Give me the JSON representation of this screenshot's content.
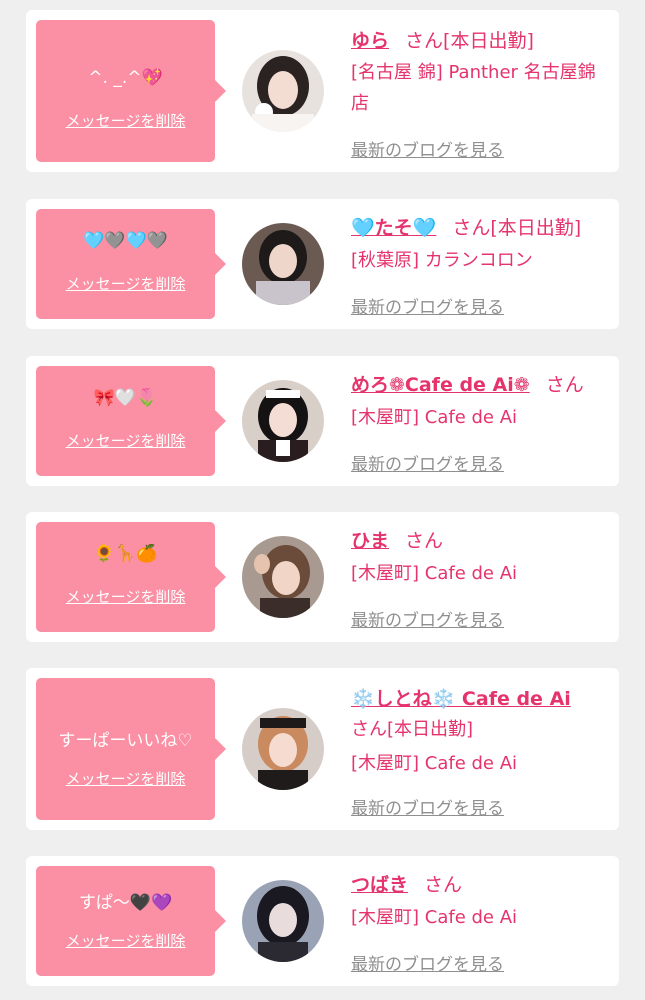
{
  "delete_label": "メッセージを削除",
  "blog_label": "最新のブログを見る",
  "san_label": "さん",
  "cards": [
    {
      "message": "^. _.^💖",
      "name": "ゆら",
      "san_suffix": "[本日出勤]",
      "shop": "[名古屋 錦] Panther 名古屋錦店"
    },
    {
      "message": "🩵🩶🩵🩶",
      "name": "🩵たそ🩵",
      "san_suffix": "[本日出勤]",
      "shop": "[秋葉原] カランコロン"
    },
    {
      "message": "🎀🤍🌷",
      "name": "めろ❁Cafe de Ai❁",
      "san_suffix": "",
      "shop": "[木屋町] Cafe de Ai"
    },
    {
      "message": "🌻🦒🍊",
      "name": "ひま",
      "san_suffix": "",
      "shop": "[木屋町] Cafe de Ai"
    },
    {
      "message": "すーぱーいいね♡",
      "name": "❄️しとね❄️ Cafe de Ai",
      "san_suffix": "[本日出勤]",
      "shop": "[木屋町] Cafe de Ai"
    },
    {
      "message": "すぱ〜🖤💜",
      "name": "つばき",
      "san_suffix": "",
      "shop": "[木屋町] Cafe de Ai"
    }
  ],
  "colors": {
    "bubble": "#fb8fa3",
    "accent": "#e5346d",
    "muted": "#8f8f8f",
    "background": "#efefef"
  }
}
